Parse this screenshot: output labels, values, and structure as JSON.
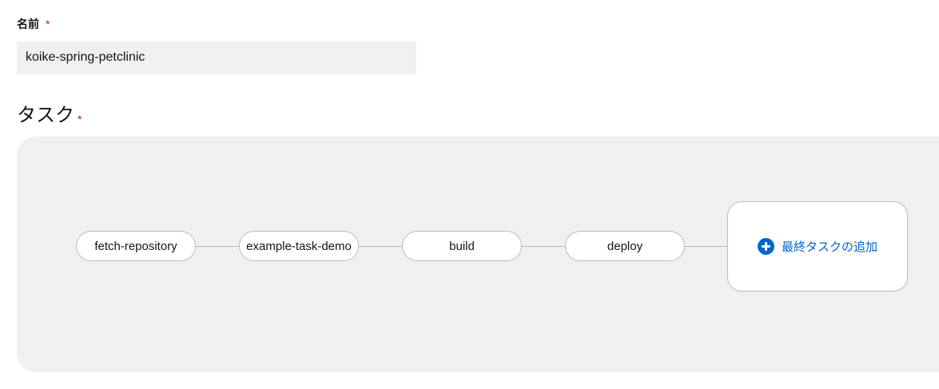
{
  "name_field": {
    "label": "名前",
    "required_marker": "*",
    "value": "koike-spring-petclinic"
  },
  "tasks_section": {
    "title": "タスク",
    "required_marker": "*"
  },
  "pipeline": {
    "tasks": [
      "fetch-repository",
      "example-task-demo",
      "build",
      "deploy"
    ],
    "add_final_task_label": "最終タスクの追加"
  },
  "colors": {
    "accent": "#0066cc",
    "required": "#c9190b",
    "canvas_background": "#f0f0f0",
    "node_border": "#b8bbbe"
  }
}
